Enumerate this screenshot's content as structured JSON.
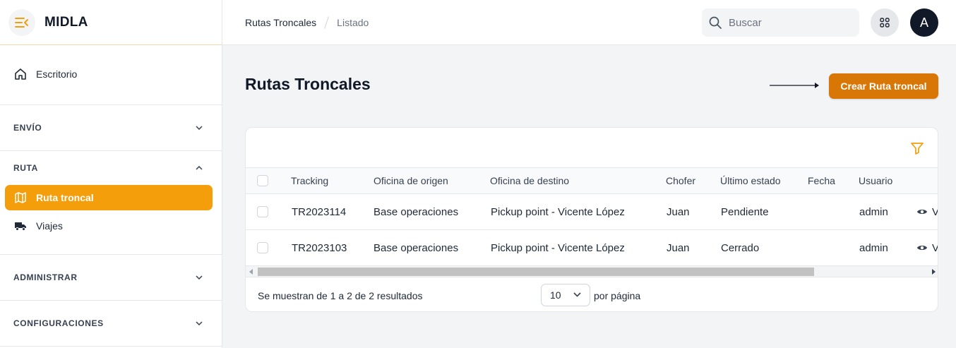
{
  "app": {
    "name": "MIDLA"
  },
  "sidebar": {
    "items": [
      {
        "label": "Escritorio"
      }
    ],
    "sections": {
      "envio": {
        "label": "ENVÍO"
      },
      "ruta": {
        "label": "RUTA",
        "items": [
          {
            "label": "Ruta troncal"
          },
          {
            "label": "Viajes"
          }
        ]
      },
      "administrar": {
        "label": "ADMINISTRAR"
      },
      "configuraciones": {
        "label": "CONFIGURACIONES"
      }
    }
  },
  "breadcrumb": [
    "Rutas Troncales",
    "Listado"
  ],
  "search": {
    "placeholder": "Buscar"
  },
  "user": {
    "initial": "A"
  },
  "page": {
    "title": "Rutas Troncales",
    "create_label": "Crear Ruta troncal"
  },
  "table": {
    "columns": [
      "Tracking",
      "Oficina de origen",
      "Oficina de destino",
      "Chofer",
      "Último estado",
      "Fecha",
      "Usuario"
    ],
    "rows": [
      {
        "tracking": "TR2023114",
        "origen": "Base operaciones",
        "destino": "Pickup point - Vicente López",
        "chofer": "Juan",
        "estado": "Pendiente",
        "fecha": "",
        "usuario": "admin",
        "action": "V"
      },
      {
        "tracking": "TR2023103",
        "origen": "Base operaciones",
        "destino": "Pickup point - Vicente López",
        "chofer": "Juan",
        "estado": "Cerrado",
        "fecha": "",
        "usuario": "admin",
        "action": "V"
      }
    ],
    "footer": {
      "summary": "Se muestran de 1 a 2 de 2 resultados",
      "per_page_value": "10",
      "per_page_label": "por página"
    }
  },
  "colors": {
    "accent": "#f59e0b",
    "button": "#d97706",
    "avatar": "#111827"
  },
  "icons": [
    "menu-collapse-icon",
    "home-icon",
    "map-icon",
    "truck-icon",
    "chevron-down-icon",
    "chevron-up-icon",
    "search-icon",
    "apps-grid-icon",
    "filter-icon",
    "eye-icon",
    "arrow-right-icon"
  ]
}
